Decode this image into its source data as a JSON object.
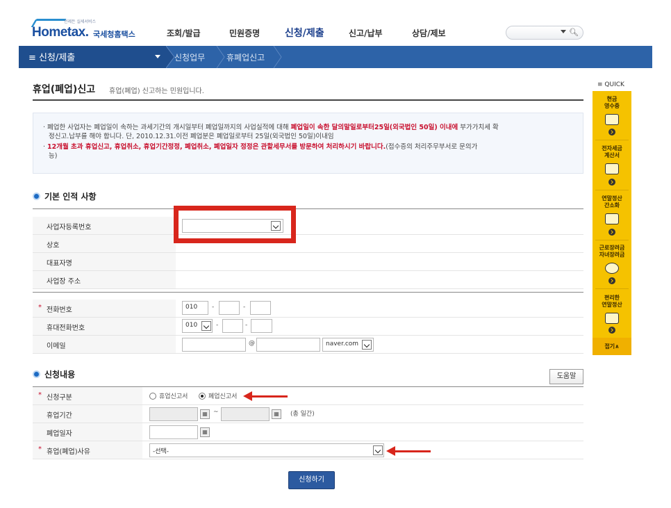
{
  "header": {
    "logo_text": "Hometax.",
    "logo_sub": "국세청홈택스",
    "logo_tagline": "언제든 실세서비스",
    "nav": [
      "조회/발급",
      "민원증명",
      "신청/제출",
      "신고/납부",
      "상담/제보"
    ],
    "active_nav": "신청/제출"
  },
  "breadcrumb": {
    "menu": "신청/제출",
    "items": [
      "신청업무",
      "휴폐업신고"
    ]
  },
  "page": {
    "title": "휴업(폐업)신고",
    "description": "휴업(폐업) 신고하는 민원입니다."
  },
  "notice": {
    "line1_a": "폐업한 사업자는 폐업일이 속하는 과세기간의 개시일부터 폐업일까지의 사업실적에 대해 ",
    "line1_red": "폐업일이 속한 달의말일로부터25일(외국법인 50일) 이내에",
    "line1_b": " 부가가치세 확",
    "line2": "정신고.납부를 해야 합니다. 단, 2010.12.31.이전 폐업분은 폐업일로부터 25일(외국법인 50일)이내임",
    "line3_red": "12개월 초과 휴업신고, 휴업취소, 휴업기간정정, 폐업취소, 폐업일자 정정은 관할세무서를 방문하여 처리하시기 바랍니다.",
    "line3_b": "(접수증의 처리주무부서로 문의가",
    "line4": "능)"
  },
  "section1": {
    "title": "기본 인적 사항",
    "biz_no_label": "사업자등록번호",
    "trade_name_label": "상호",
    "rep_label": "대표자명",
    "addr_label": "사업장 주소",
    "phone_label": "전화번호",
    "phone_prefix": "010",
    "mobile_label": "휴대전화번호",
    "mobile_prefix": "010",
    "email_label": "이메일",
    "email_at": "@",
    "email_domain": "naver.com",
    "dash": "-"
  },
  "section2": {
    "title": "신청내용",
    "help": "도움말",
    "type_label": "신청구분",
    "type_opt1": "휴업신고서",
    "type_opt2": "폐업신고서",
    "selected_type": "폐업신고서",
    "period_label": "휴업기간",
    "period_tilde": "~",
    "period_total": "(총   일간)",
    "close_date_label": "폐업일자",
    "reason_label": "휴업(폐업)사유",
    "reason_value": "-선택-"
  },
  "submit_label": "신청하기",
  "quick": {
    "label": "≡ QUICK",
    "items": [
      "현금영수증",
      "전자세금계산서",
      "연말정산간소화",
      "근로장려금 자녀장려금",
      "편리한 연말정산"
    ],
    "items_display": [
      [
        "현금",
        "영수증"
      ],
      [
        "전자세금",
        "계산서"
      ],
      [
        "연말정산",
        "간소화"
      ],
      [
        "근로장려금",
        "자녀장려금"
      ],
      [
        "편리한",
        "연말정산"
      ]
    ],
    "close": "접기∧"
  },
  "colors": {
    "brand_blue": "#2d63a8",
    "highlight_red": "#d8261c",
    "quick_yellow": "#f5c200"
  }
}
